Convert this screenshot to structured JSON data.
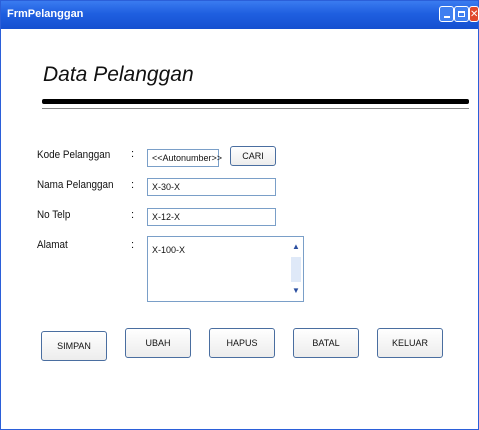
{
  "window": {
    "title": "FrmPelanggan"
  },
  "header": {
    "title": "Data Pelanggan"
  },
  "form": {
    "kode": {
      "label": "Kode Pelanggan",
      "colon": ":",
      "value": "<<Autonumber>>"
    },
    "cari_label": "CARI",
    "nama": {
      "label": "Nama Pelanggan",
      "colon": ":",
      "value": "X-30-X"
    },
    "telp": {
      "label": "No Telp",
      "colon": ":",
      "value": "X-12-X"
    },
    "alamat": {
      "label": "Alamat",
      "colon": ":",
      "value": "X-100-X"
    }
  },
  "buttons": {
    "simpan": "SIMPAN",
    "ubah": "UBAH",
    "hapus": "HAPUS",
    "batal": "BATAL",
    "keluar": "KELUAR"
  },
  "icons": {
    "minimize": "minimize-icon",
    "maximize": "maximize-icon",
    "close": "close-icon",
    "scroll_up": "chevron-up-icon",
    "scroll_down": "chevron-down-icon"
  },
  "colors": {
    "titlebar": "#1f5fe0",
    "close_button": "#e0472b",
    "field_border": "#7a9fc8"
  }
}
